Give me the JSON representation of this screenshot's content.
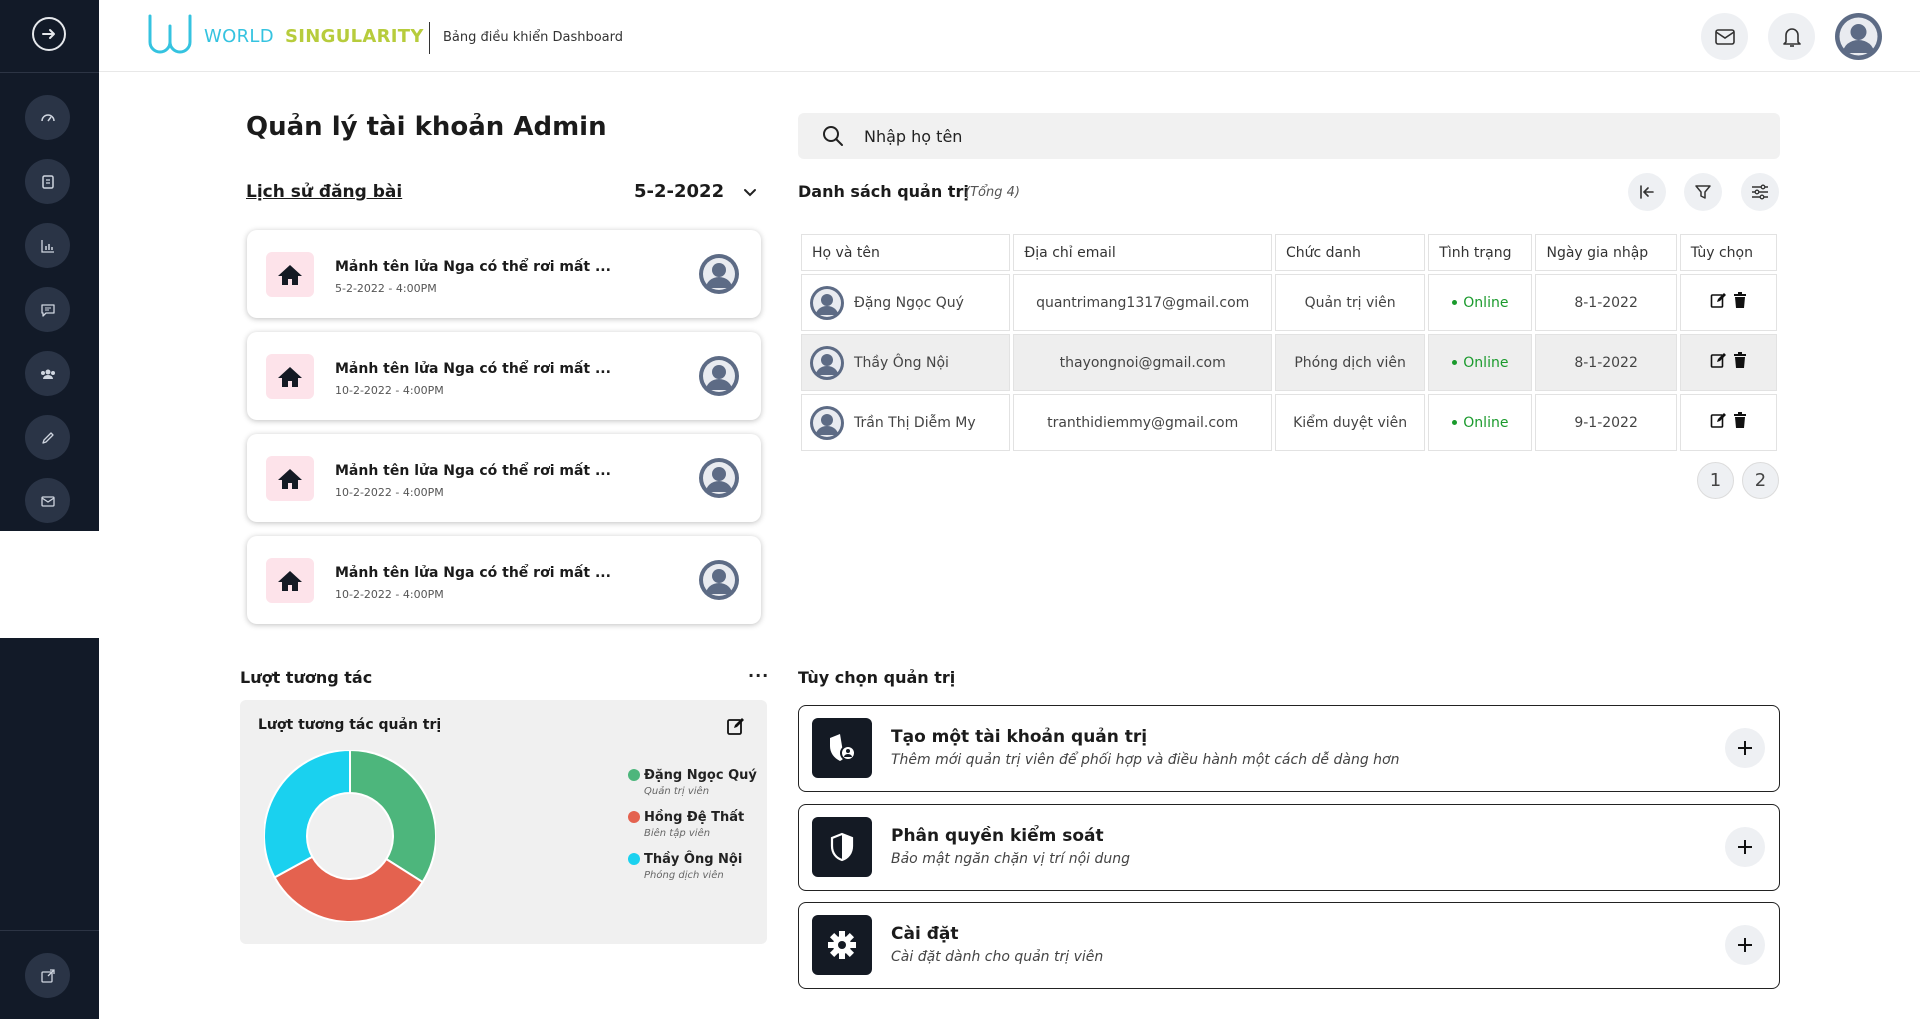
{
  "header": {
    "brand_part1": "WORLD",
    "brand_part2": "SINGULARITY",
    "subtitle": "Bảng điều khiển Dashboard"
  },
  "sidebar": {
    "items": [
      {
        "icon": "dashboard-gauge-icon"
      },
      {
        "icon": "document-icon"
      },
      {
        "icon": "bar-chart-icon"
      },
      {
        "icon": "message-icon"
      },
      {
        "icon": "users-group-icon"
      },
      {
        "icon": "pencil-icon"
      },
      {
        "icon": "mail-icon"
      }
    ],
    "bottom_item": {
      "icon": "external-link-icon"
    }
  },
  "page_title": "Quản lý tài khoản Admin",
  "history": {
    "title": "Lịch sử đăng bài",
    "date": "5-2-2022",
    "posts": [
      {
        "title": "Mảnh tên lửa Nga có thể rơi mất ...",
        "date": "5-2-2022 - 4:00PM"
      },
      {
        "title": "Mảnh tên lửa Nga có thể rơi mất ...",
        "date": "10-2-2022 - 4:00PM"
      },
      {
        "title": "Mảnh tên lửa Nga có thể rơi mất ...",
        "date": "10-2-2022 - 4:00PM"
      },
      {
        "title": "Mảnh tên lửa Nga có thể rơi mất ...",
        "date": "10-2-2022 - 4:00PM"
      }
    ]
  },
  "search": {
    "placeholder": "Nhập họ tên"
  },
  "admin_list": {
    "title": "Danh sách quản trị",
    "count": "(Tổng 4)",
    "columns": [
      "Họ và tên",
      "Địa chỉ email",
      "Chức danh",
      "Tình trạng",
      "Ngày gia nhập",
      "Tùy chọn"
    ],
    "rows": [
      {
        "name": "Đặng Ngọc Quý",
        "email": "quantrimang1317@gmail.com",
        "role": "Quản trị viên",
        "status": "Online",
        "joined": "8-1-2022"
      },
      {
        "name": "Thầy Ông Nội",
        "email": "thayongnoi@gmail.com",
        "role": "Phóng dịch viên",
        "status": "Online",
        "joined": "8-1-2022"
      },
      {
        "name": "Trần Thị Diễm My",
        "email": "tranthidiemmy@gmail.com",
        "role": "Kiểm duyệt viên",
        "status": "Online",
        "joined": "9-1-2022"
      }
    ],
    "pages": [
      "1",
      "2"
    ]
  },
  "interactions": {
    "title": "Lượt tương tác",
    "more": "···",
    "chart_title": "Lượt tương tác quản trị"
  },
  "chart_data": {
    "type": "pie",
    "title": "Lượt tương tác quản trị",
    "categories": [
      "Đặng Ngọc Quý",
      "Hồng Đệ Thất",
      "Thầy Ông Nội"
    ],
    "roles": [
      "Quản trị viên",
      "Biên tập viên",
      "Phóng dịch viên"
    ],
    "values": [
      34,
      33,
      33
    ],
    "colors": [
      "#4db67c",
      "#e4624f",
      "#1ad1ef"
    ],
    "legend_position": "right"
  },
  "options": {
    "title": "Tùy chọn quản trị",
    "items": [
      {
        "name": "Tạo một tài khoản quản trị",
        "desc": "Thêm mới quản trị viên để phối hợp và điều hành một cách dễ dàng hơn",
        "icon": "shield-user-icon"
      },
      {
        "name": "Phân quyền kiểm soát",
        "desc": "Bảo mật ngăn chặn vị trí nội dung",
        "icon": "shield-icon"
      },
      {
        "name": "Cài đặt",
        "desc": "Cài đặt dành cho quản trị viên",
        "icon": "gear-icon"
      }
    ]
  },
  "colors": {
    "sidebar_bg": "#121a28",
    "brand_cyan": "#35c3e0",
    "brand_lime": "#b7cc3c",
    "online": "#1a9a2c",
    "post_icon_bg": "#fde3ea"
  }
}
